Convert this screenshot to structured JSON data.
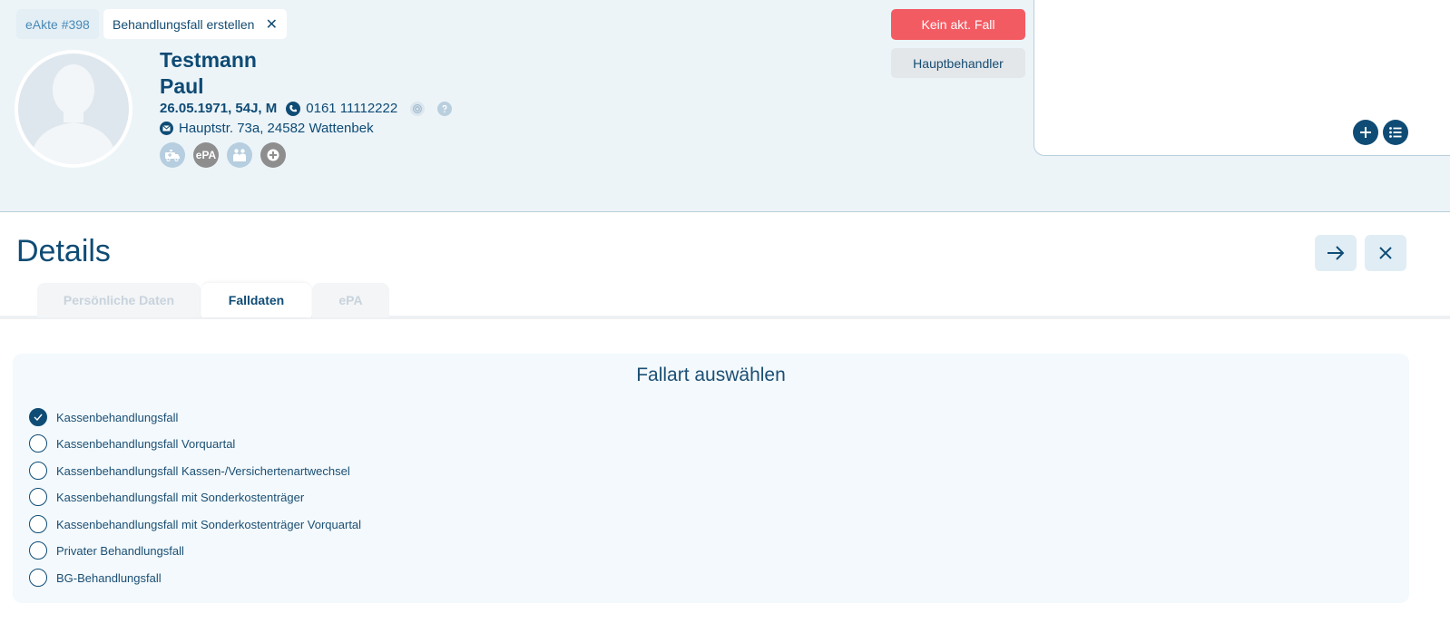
{
  "header": {
    "chip_akte": "eAkte #398",
    "chip_active": "Behandlungsfall erstellen",
    "close_glyph": "✕",
    "last_name": "Testmann",
    "first_name": "Paul",
    "dob_line": "26.05.1971, 54J, M",
    "phone": "0161 11112222",
    "address": "Hauptstr. 73a, 24582 Wattenbek",
    "badges": [
      {
        "icon": "ambulance-icon",
        "color": "#b6cedf"
      },
      {
        "label": "ePA",
        "color": "#8e8e8e"
      },
      {
        "icon": "family-icon",
        "color": "#b6cedf"
      },
      {
        "icon": "add-badge-icon",
        "color": "#8e8e8e"
      }
    ],
    "btn_case": "Kein akt. Fall",
    "btn_main": "Hauptbehandler"
  },
  "details": {
    "title": "Details",
    "tabs": [
      {
        "label": "Persönliche Daten",
        "active": false
      },
      {
        "label": "Falldaten",
        "active": true
      },
      {
        "label": "ePA",
        "active": false
      }
    ]
  },
  "fallart": {
    "title": "Fallart auswählen",
    "options": [
      {
        "label": "Kassenbehandlungsfall",
        "checked": true
      },
      {
        "label": "Kassenbehandlungsfall Vorquartal",
        "checked": false
      },
      {
        "label": "Kassenbehandlungsfall Kassen-/Versichertenartwechsel",
        "checked": false
      },
      {
        "label": "Kassenbehandlungsfall mit Sonderkostenträger",
        "checked": false
      },
      {
        "label": "Kassenbehandlungsfall mit Sonderkostenträger Vorquartal",
        "checked": false
      },
      {
        "label": "Privater Behandlungsfall",
        "checked": false
      },
      {
        "label": "BG-Behandlungsfall",
        "checked": false
      }
    ]
  },
  "colors": {
    "accent": "#0f4c75",
    "danger": "#f35b63",
    "header_bg": "#ecf4f8"
  }
}
